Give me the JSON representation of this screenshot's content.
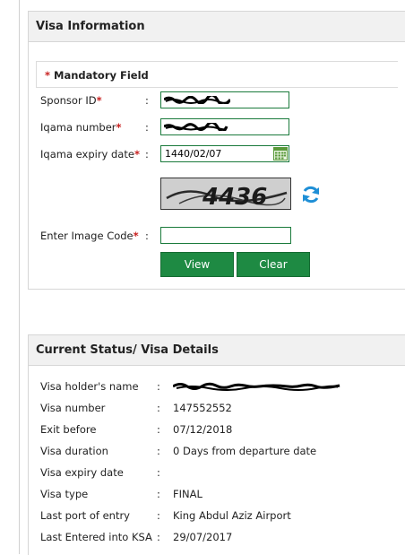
{
  "visa_information": {
    "title": "Visa Information",
    "mandatory_star": "*",
    "mandatory_text": "Mandatory Field",
    "colon": ":",
    "required_star": "*",
    "sponsor_id": {
      "label": "Sponsor ID",
      "value": ""
    },
    "iqama_number": {
      "label": "Iqama number",
      "value": ""
    },
    "iqama_expiry": {
      "label": "Iqama expiry date",
      "value": "1440/02/07"
    },
    "captcha_text": "4436",
    "image_code": {
      "label": "Enter Image Code",
      "value": ""
    },
    "view_label": "View",
    "clear_label": "Clear",
    "accent_color": "#1e8a43"
  },
  "current_status": {
    "title": "Current Status/ Visa Details",
    "rows": [
      {
        "label": "Visa holder's name",
        "value": ""
      },
      {
        "label": "Visa number",
        "value": "147552552"
      },
      {
        "label": "Exit before",
        "value": "07/12/2018"
      },
      {
        "label": "Visa duration",
        "value": "0 Days from departure date"
      },
      {
        "label": "Visa expiry date",
        "value": ""
      },
      {
        "label": "Visa type",
        "value": "FINAL"
      },
      {
        "label": "Last port of entry",
        "value": "King Abdul Aziz Airport"
      },
      {
        "label": "Last Entered into KSA",
        "value": "29/07/2017"
      }
    ]
  }
}
